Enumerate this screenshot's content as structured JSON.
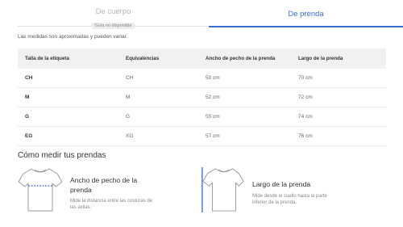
{
  "tabs": {
    "body": {
      "label": "De cuerpo",
      "badge": "Guía no disponible"
    },
    "garment": {
      "label": "De prenda"
    }
  },
  "note": "Las medidas son aproximadas y pueden variar.",
  "table": {
    "headers": [
      "Talla de la etiqueta",
      "Equivalencias",
      "Ancho de pecho de la prenda",
      "Largo de la prenda"
    ],
    "rows": [
      [
        "CH",
        "CH",
        "50 cm",
        "70 cm"
      ],
      [
        "M",
        "M",
        "52 cm",
        "72 cm"
      ],
      [
        "G",
        "G",
        "55 cm",
        "74 cm"
      ],
      [
        "EG",
        "XG",
        "57 cm",
        "76 cm"
      ]
    ]
  },
  "measure": {
    "title": "Cómo medir tus prendas",
    "cards": [
      {
        "title": "Ancho de pecho de la prenda",
        "text": "Mide la distancia entre las costuras de las axilas.",
        "icon": "tshirt-chest-icon"
      },
      {
        "title": "Largo de la prenda",
        "text": "Mide desde el cuello hasta la parte inferior de la prenda.",
        "icon": "tshirt-length-icon"
      }
    ]
  },
  "colors": {
    "accent": "#3a6fd8",
    "header_bg": "#f1f1f2"
  }
}
